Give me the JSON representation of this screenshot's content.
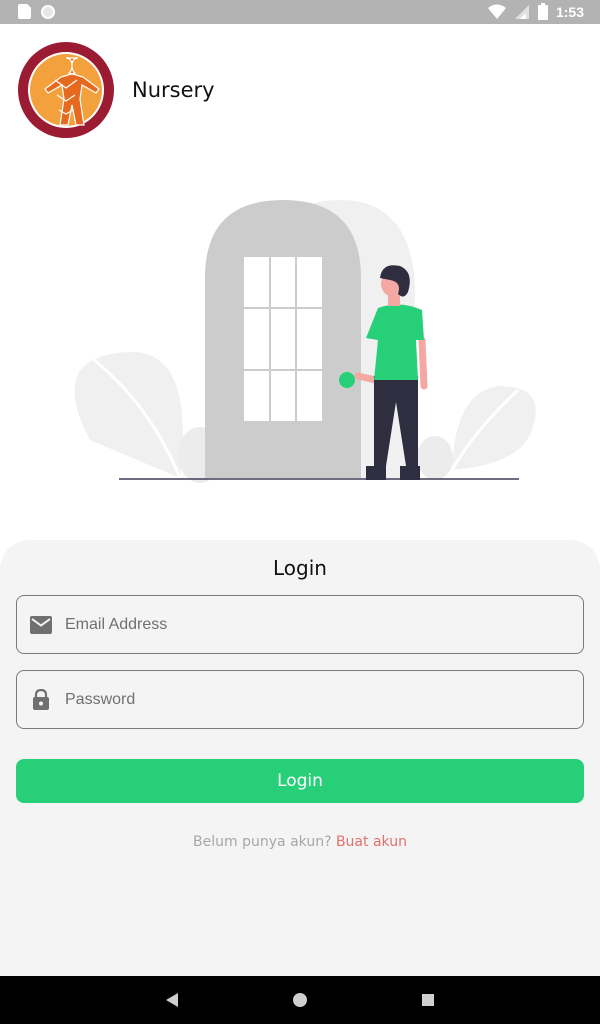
{
  "status_bar": {
    "time": "1:53",
    "icons": [
      "sim-card-icon",
      "notification-dot-icon",
      "wifi-icon",
      "signal-icon",
      "battery-icon"
    ]
  },
  "header": {
    "app_title": "Nursery",
    "logo": "departemen-anatomi-logo-icon"
  },
  "illustration": "person-opening-door-illustration",
  "login": {
    "title": "Login",
    "email": {
      "placeholder": "Email Address",
      "value": "",
      "icon": "mail-icon"
    },
    "password": {
      "placeholder": "Password",
      "value": "",
      "icon": "lock-icon"
    },
    "button_label": "Login",
    "signup_prompt": "Belum punya akun?",
    "signup_link": "Buat akun"
  },
  "nav_bar": {
    "buttons": [
      "back-icon",
      "home-icon",
      "recent-apps-icon"
    ]
  },
  "colors": {
    "accent": "#27d078",
    "link": "#e0726e",
    "card_bg": "#f4f4f4",
    "status_bar_bg": "#b3b3b3"
  }
}
